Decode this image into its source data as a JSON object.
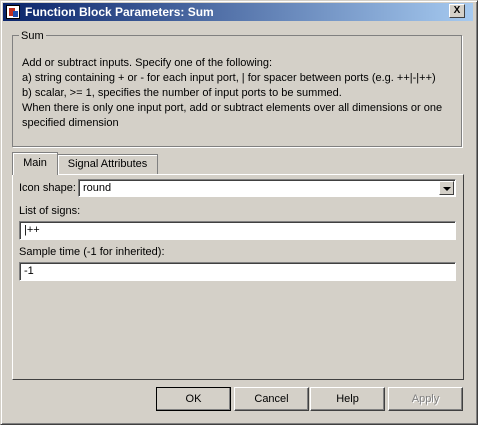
{
  "window": {
    "title": "Function Block Parameters: Sum",
    "close_label": "X"
  },
  "group": {
    "title": "Sum",
    "description": [
      "Add or subtract inputs.  Specify one of the following:",
      "a) string containing + or - for each input port, | for spacer between ports (e.g. ++|-|++)",
      "b) scalar, >= 1, specifies the number of input ports to be summed.",
      "When there is only one input port, add or subtract elements over all dimensions or one",
      "specified dimension"
    ]
  },
  "tabs": [
    {
      "label": "Main",
      "active": true
    },
    {
      "label": "Signal Attributes",
      "active": false
    }
  ],
  "params": {
    "icon_shape": {
      "label": "Icon shape:",
      "value": "round"
    },
    "list_of_signs": {
      "label": "List of signs:",
      "value": "|++"
    },
    "sample_time": {
      "label": "Sample time (-1 for inherited):",
      "value": "-1"
    }
  },
  "buttons": {
    "ok": "OK",
    "cancel": "Cancel",
    "help": "Help",
    "apply": "Apply"
  }
}
